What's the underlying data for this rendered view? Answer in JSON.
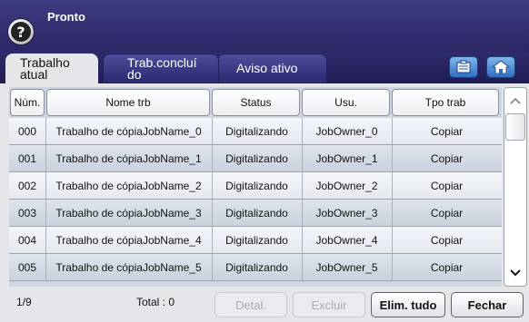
{
  "header": {
    "status": "Pronto",
    "help_symbol": "?"
  },
  "tabs": [
    {
      "label_line1": "Trabalho",
      "label_line2": "atual"
    },
    {
      "label_line1": "Trab.concluí",
      "label_line2": "do"
    },
    {
      "label": "Aviso ativo"
    }
  ],
  "table": {
    "columns": [
      "Núm.",
      "Nome trb",
      "Status",
      "Usu.",
      "Tpo trab"
    ],
    "rows": [
      [
        "000",
        "Trabalho de cópiaJobName_0",
        "Digitalizando",
        "JobOwner_0",
        "Copiar"
      ],
      [
        "001",
        "Trabalho de cópiaJobName_1",
        "Digitalizando",
        "JobOwner_1",
        "Copiar"
      ],
      [
        "002",
        "Trabalho de cópiaJobName_2",
        "Digitalizando",
        "JobOwner_2",
        "Copiar"
      ],
      [
        "003",
        "Trabalho de cópiaJobName_3",
        "Digitalizando",
        "JobOwner_3",
        "Copiar"
      ],
      [
        "004",
        "Trabalho de cópiaJobName_4",
        "Digitalizando",
        "JobOwner_4",
        "Copiar"
      ],
      [
        "005",
        "Trabalho de cópiaJobName_5",
        "Digitalizando",
        "JobOwner_5",
        "Copiar"
      ]
    ]
  },
  "footer": {
    "page": "1/9",
    "total": "Total : 0",
    "buttons": {
      "details": "Detal.",
      "delete": "Excluir",
      "delete_all": "Elim. tudo",
      "close": "Fechar"
    }
  },
  "icons": {
    "scroll_up": "chevron-up-icon",
    "scroll_down": "chevron-down-icon",
    "job_status_icon": "document-list-icon",
    "home_icon": "home-icon"
  }
}
